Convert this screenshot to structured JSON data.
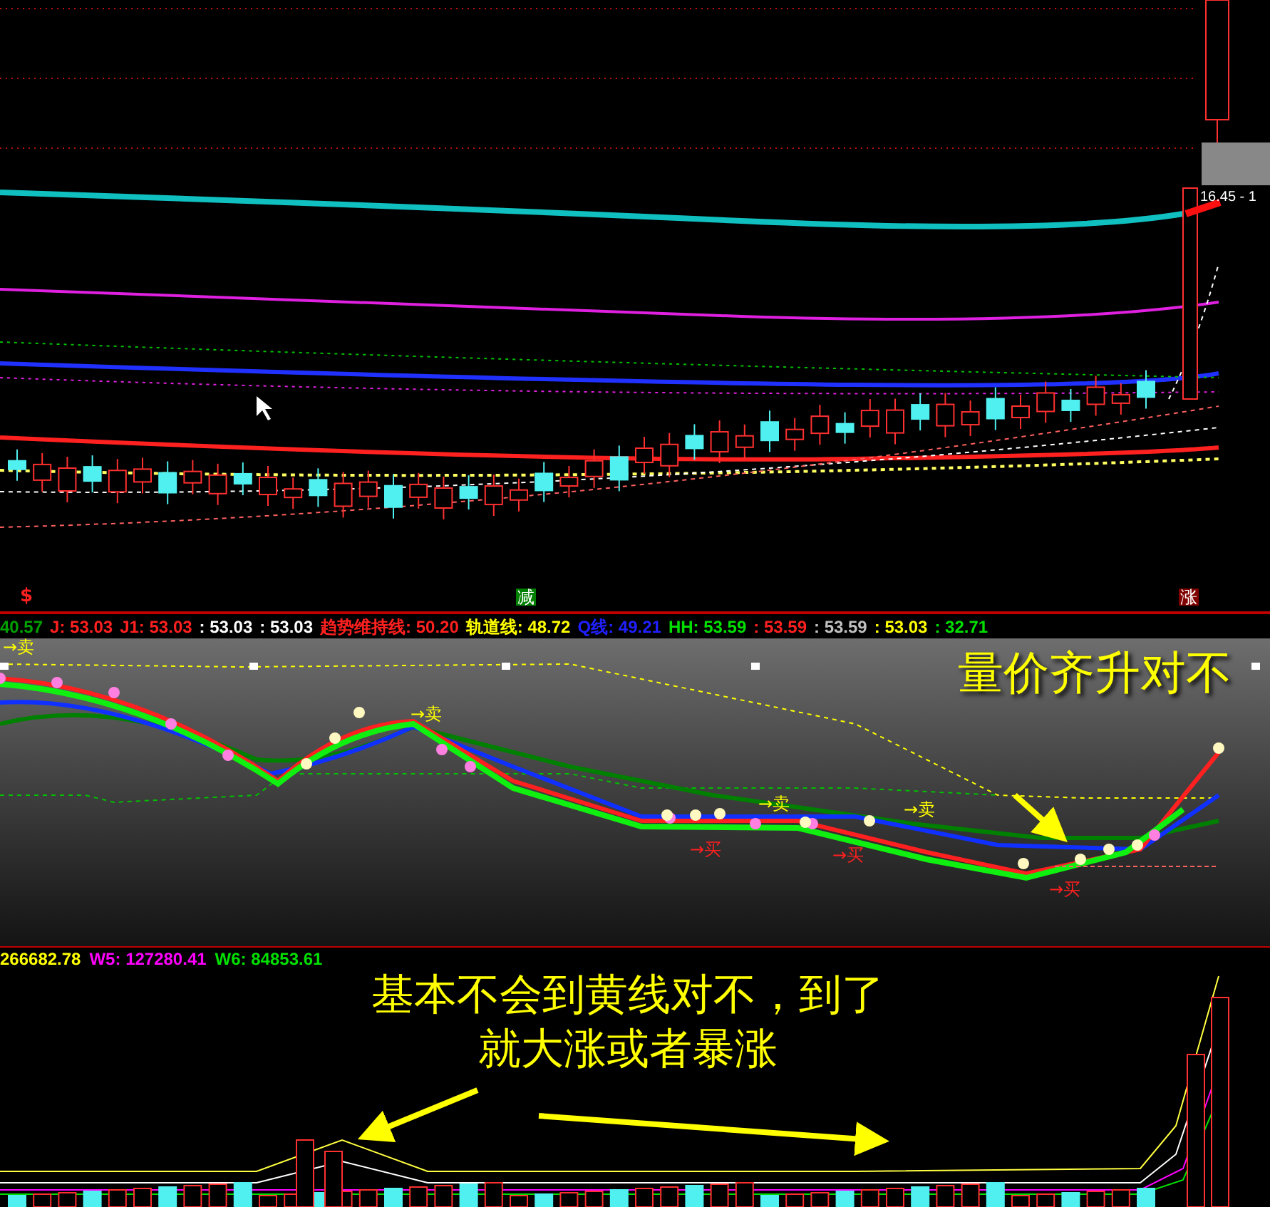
{
  "main_chart": {
    "price_label": "16.45 - 1",
    "markers": [
      {
        "text": "$",
        "kind": "plain",
        "color": "#ff2020"
      },
      {
        "text": "减",
        "kind": "boxed",
        "color": "#008000"
      },
      {
        "text": "涨",
        "kind": "boxed",
        "color": "#800000"
      }
    ]
  },
  "indicator_legend": [
    {
      "text": "40.57",
      "color": "#00a000"
    },
    {
      "text": "J: 53.03",
      "color": "#ff2020"
    },
    {
      "text": "J1: 53.03",
      "color": "#ff2020"
    },
    {
      "text": ": 53.03",
      "color": "#ffffff"
    },
    {
      "text": ": 53.03",
      "color": "#ffffff"
    },
    {
      "text": "趋势维持线: 50.20",
      "color": "#ff2020"
    },
    {
      "text": "轨道线: 48.72",
      "color": "#ffff00"
    },
    {
      "text": "Q线: 49.21",
      "color": "#2020ff"
    },
    {
      "text": "HH: 53.59",
      "color": "#00e000"
    },
    {
      "text": ": 53.59",
      "color": "#ff2020"
    },
    {
      "text": ": 53.59",
      "color": "#c0c0c0"
    },
    {
      "text": ": 53.03",
      "color": "#ffff00"
    },
    {
      "text": ": 32.71",
      "color": "#00e000"
    }
  ],
  "indicator_panel": {
    "signals": [
      {
        "text": "→卖",
        "kind": "sell"
      },
      {
        "text": "→卖",
        "kind": "sell"
      },
      {
        "text": "→买",
        "kind": "buy"
      },
      {
        "text": "→卖",
        "kind": "sell"
      },
      {
        "text": "→买",
        "kind": "buy"
      },
      {
        "text": "→卖",
        "kind": "sell"
      },
      {
        "text": "→买",
        "kind": "buy"
      }
    ],
    "annotation": "量价齐升对不"
  },
  "volume_legend": [
    {
      "text": "266682.78",
      "color": "#ffff00"
    },
    {
      "text": "W5: 127280.41",
      "color": "#ff00ff"
    },
    {
      "text": "W6: 84853.61",
      "color": "#00e000"
    }
  ],
  "volume_panel": {
    "annotation_lines": [
      "基本不会到黄线对不，到了",
      "就大涨或者暴涨"
    ]
  }
}
